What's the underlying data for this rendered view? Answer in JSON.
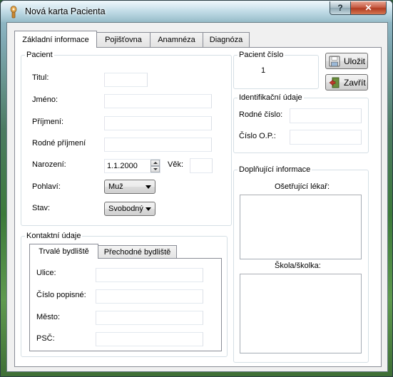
{
  "window": {
    "title": "Nová karta Pacienta",
    "help_label": "?",
    "close_label": "✕"
  },
  "tabs": [
    "Základní informace",
    "Pojišťovna",
    "Anamnéza",
    "Diagnóza"
  ],
  "pacient": {
    "legend": "Pacient",
    "titul_label": "Titul:",
    "titul_value": "",
    "jmeno_label": "Jméno:",
    "jmeno_value": "",
    "prijmeni_label": "Příjmení:",
    "prijmeni_value": "",
    "rodne_prijmeni_label": "Rodné příjmení",
    "rodne_prijmeni_value": "",
    "narozeni_label": "Narození:",
    "narozeni_value": "1.1.2000",
    "vek_label": "Věk:",
    "vek_value": "",
    "pohlavi_label": "Pohlaví:",
    "pohlavi_value": "Muž",
    "stav_label": "Stav:",
    "stav_value": "Svobodný"
  },
  "pacient_cislo": {
    "legend": "Pacient číslo",
    "value": "1"
  },
  "buttons": {
    "save_label": "Uložit",
    "close_label": "Zavřít"
  },
  "identifikacni": {
    "legend": "Identifikační údaje",
    "rodne_cislo_label": "Rodné číslo:",
    "rodne_cislo_value": "",
    "cislo_op_label": "Číslo O.P.:",
    "cislo_op_value": ""
  },
  "kontakt": {
    "legend": "Kontaktní údaje",
    "tabs": [
      "Trvalé bydliště",
      "Přechodné bydliště"
    ],
    "ulice_label": "Ulice:",
    "ulice_value": "",
    "cislo_popisne_label": "Číslo popisné:",
    "cislo_popisne_value": "",
    "mesto_label": "Město:",
    "mesto_value": "",
    "psc_label": "PSČ:",
    "psc_value": ""
  },
  "doplnujici": {
    "legend": "Doplňující informace",
    "lekar_label": "Ošetřující lékař:",
    "lekar_value": "",
    "skola_label": "Škola/školka:",
    "skola_value": ""
  },
  "icons": {
    "app": "app-icon",
    "save": "floppy-disk-icon",
    "close": "exit-door-icon"
  },
  "colors": {
    "accent": "#3399ff",
    "window_bg": "#f0f0f0"
  }
}
